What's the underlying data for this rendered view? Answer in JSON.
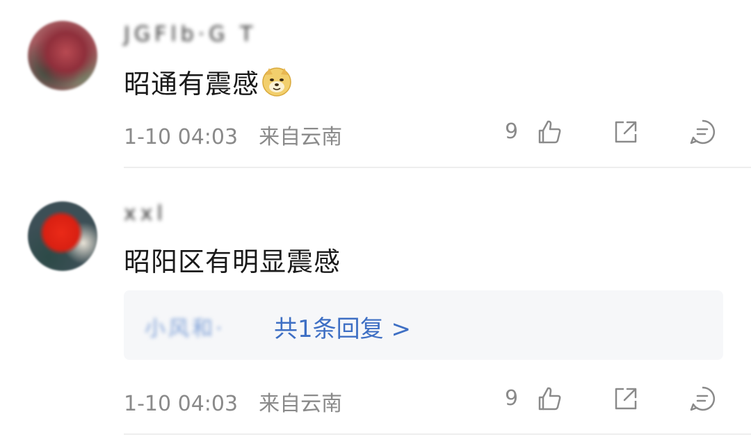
{
  "comments": [
    {
      "username": "JGFlb·G T",
      "text": "昭通有震感",
      "emoji": "doge-emoji",
      "time": "1-10 04:03",
      "location": "来自云南",
      "likes": "9"
    },
    {
      "username": "xxl",
      "text": "昭阳区有明显震感",
      "reply_preview_name": "小风和·",
      "reply_link": "共1条回复 >",
      "time": "1-10 04:03",
      "location": "来自云南",
      "likes": "9"
    }
  ],
  "icons": {
    "like": "thumbs-up-icon",
    "share": "share-icon",
    "comment": "comment-icon"
  },
  "colors": {
    "meta_text": "#8a8a8a",
    "reply_link": "#3e6fc4",
    "reply_bg": "#f6f7f9"
  }
}
